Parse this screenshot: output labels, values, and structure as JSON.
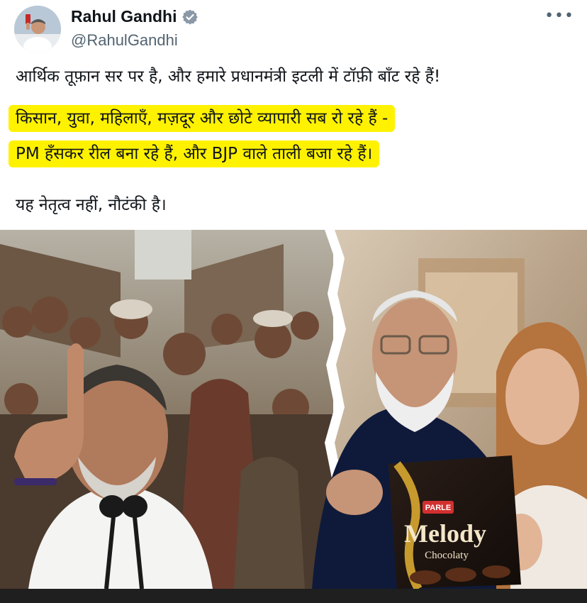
{
  "author": {
    "display_name": "Rahul Gandhi",
    "handle": "@RahulGandhi",
    "verified": true
  },
  "menu": {
    "more_label": "•••"
  },
  "tweet": {
    "line1": "आर्थिक तूफ़ान सर पर है, और हमारे प्रधानमंत्री इटली में टॉफ़ी बाँट रहे हैं!",
    "highlight_line1": "किसान, युवा, महिलाएँ, मज़दूर और छोटे व्यापारी सब रो रहे हैं -",
    "highlight_line2": "PM हँसकर रील बना रहे हैं, और BJP वाले ताली बजा रहे हैं।",
    "line_last": "यह नेतृत्व नहीं, नौटंकी है।"
  },
  "media": {
    "package_brand": "PARLE",
    "package_name": "Melody",
    "package_subname": "Chocolaty"
  },
  "colors": {
    "highlight": "#fff200",
    "verified_blue": "#1d9bf0",
    "muted_text": "#536471"
  }
}
